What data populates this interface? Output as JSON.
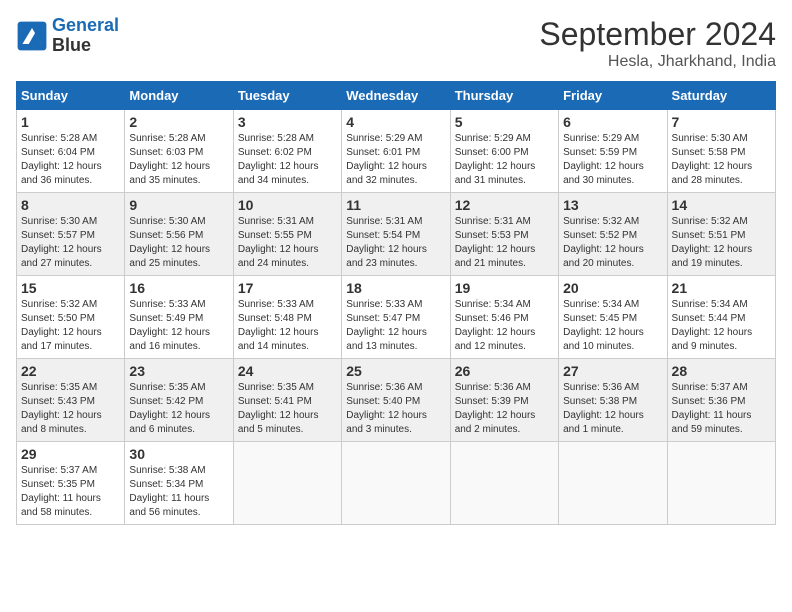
{
  "header": {
    "logo_line1": "General",
    "logo_line2": "Blue",
    "month_title": "September 2024",
    "subtitle": "Hesla, Jharkhand, India"
  },
  "weekdays": [
    "Sunday",
    "Monday",
    "Tuesday",
    "Wednesday",
    "Thursday",
    "Friday",
    "Saturday"
  ],
  "weeks": [
    [
      {
        "day": "1",
        "sunrise": "5:28 AM",
        "sunset": "6:04 PM",
        "daylight": "12 hours and 36 minutes."
      },
      {
        "day": "2",
        "sunrise": "5:28 AM",
        "sunset": "6:03 PM",
        "daylight": "12 hours and 35 minutes."
      },
      {
        "day": "3",
        "sunrise": "5:28 AM",
        "sunset": "6:02 PM",
        "daylight": "12 hours and 34 minutes."
      },
      {
        "day": "4",
        "sunrise": "5:29 AM",
        "sunset": "6:01 PM",
        "daylight": "12 hours and 32 minutes."
      },
      {
        "day": "5",
        "sunrise": "5:29 AM",
        "sunset": "6:00 PM",
        "daylight": "12 hours and 31 minutes."
      },
      {
        "day": "6",
        "sunrise": "5:29 AM",
        "sunset": "5:59 PM",
        "daylight": "12 hours and 30 minutes."
      },
      {
        "day": "7",
        "sunrise": "5:30 AM",
        "sunset": "5:58 PM",
        "daylight": "12 hours and 28 minutes."
      }
    ],
    [
      {
        "day": "8",
        "sunrise": "5:30 AM",
        "sunset": "5:57 PM",
        "daylight": "12 hours and 27 minutes."
      },
      {
        "day": "9",
        "sunrise": "5:30 AM",
        "sunset": "5:56 PM",
        "daylight": "12 hours and 25 minutes."
      },
      {
        "day": "10",
        "sunrise": "5:31 AM",
        "sunset": "5:55 PM",
        "daylight": "12 hours and 24 minutes."
      },
      {
        "day": "11",
        "sunrise": "5:31 AM",
        "sunset": "5:54 PM",
        "daylight": "12 hours and 23 minutes."
      },
      {
        "day": "12",
        "sunrise": "5:31 AM",
        "sunset": "5:53 PM",
        "daylight": "12 hours and 21 minutes."
      },
      {
        "day": "13",
        "sunrise": "5:32 AM",
        "sunset": "5:52 PM",
        "daylight": "12 hours and 20 minutes."
      },
      {
        "day": "14",
        "sunrise": "5:32 AM",
        "sunset": "5:51 PM",
        "daylight": "12 hours and 19 minutes."
      }
    ],
    [
      {
        "day": "15",
        "sunrise": "5:32 AM",
        "sunset": "5:50 PM",
        "daylight": "12 hours and 17 minutes."
      },
      {
        "day": "16",
        "sunrise": "5:33 AM",
        "sunset": "5:49 PM",
        "daylight": "12 hours and 16 minutes."
      },
      {
        "day": "17",
        "sunrise": "5:33 AM",
        "sunset": "5:48 PM",
        "daylight": "12 hours and 14 minutes."
      },
      {
        "day": "18",
        "sunrise": "5:33 AM",
        "sunset": "5:47 PM",
        "daylight": "12 hours and 13 minutes."
      },
      {
        "day": "19",
        "sunrise": "5:34 AM",
        "sunset": "5:46 PM",
        "daylight": "12 hours and 12 minutes."
      },
      {
        "day": "20",
        "sunrise": "5:34 AM",
        "sunset": "5:45 PM",
        "daylight": "12 hours and 10 minutes."
      },
      {
        "day": "21",
        "sunrise": "5:34 AM",
        "sunset": "5:44 PM",
        "daylight": "12 hours and 9 minutes."
      }
    ],
    [
      {
        "day": "22",
        "sunrise": "5:35 AM",
        "sunset": "5:43 PM",
        "daylight": "12 hours and 8 minutes."
      },
      {
        "day": "23",
        "sunrise": "5:35 AM",
        "sunset": "5:42 PM",
        "daylight": "12 hours and 6 minutes."
      },
      {
        "day": "24",
        "sunrise": "5:35 AM",
        "sunset": "5:41 PM",
        "daylight": "12 hours and 5 minutes."
      },
      {
        "day": "25",
        "sunrise": "5:36 AM",
        "sunset": "5:40 PM",
        "daylight": "12 hours and 3 minutes."
      },
      {
        "day": "26",
        "sunrise": "5:36 AM",
        "sunset": "5:39 PM",
        "daylight": "12 hours and 2 minutes."
      },
      {
        "day": "27",
        "sunrise": "5:36 AM",
        "sunset": "5:38 PM",
        "daylight": "12 hours and 1 minute."
      },
      {
        "day": "28",
        "sunrise": "5:37 AM",
        "sunset": "5:36 PM",
        "daylight": "11 hours and 59 minutes."
      }
    ],
    [
      {
        "day": "29",
        "sunrise": "5:37 AM",
        "sunset": "5:35 PM",
        "daylight": "11 hours and 58 minutes."
      },
      {
        "day": "30",
        "sunrise": "5:38 AM",
        "sunset": "5:34 PM",
        "daylight": "11 hours and 56 minutes."
      },
      null,
      null,
      null,
      null,
      null
    ]
  ]
}
